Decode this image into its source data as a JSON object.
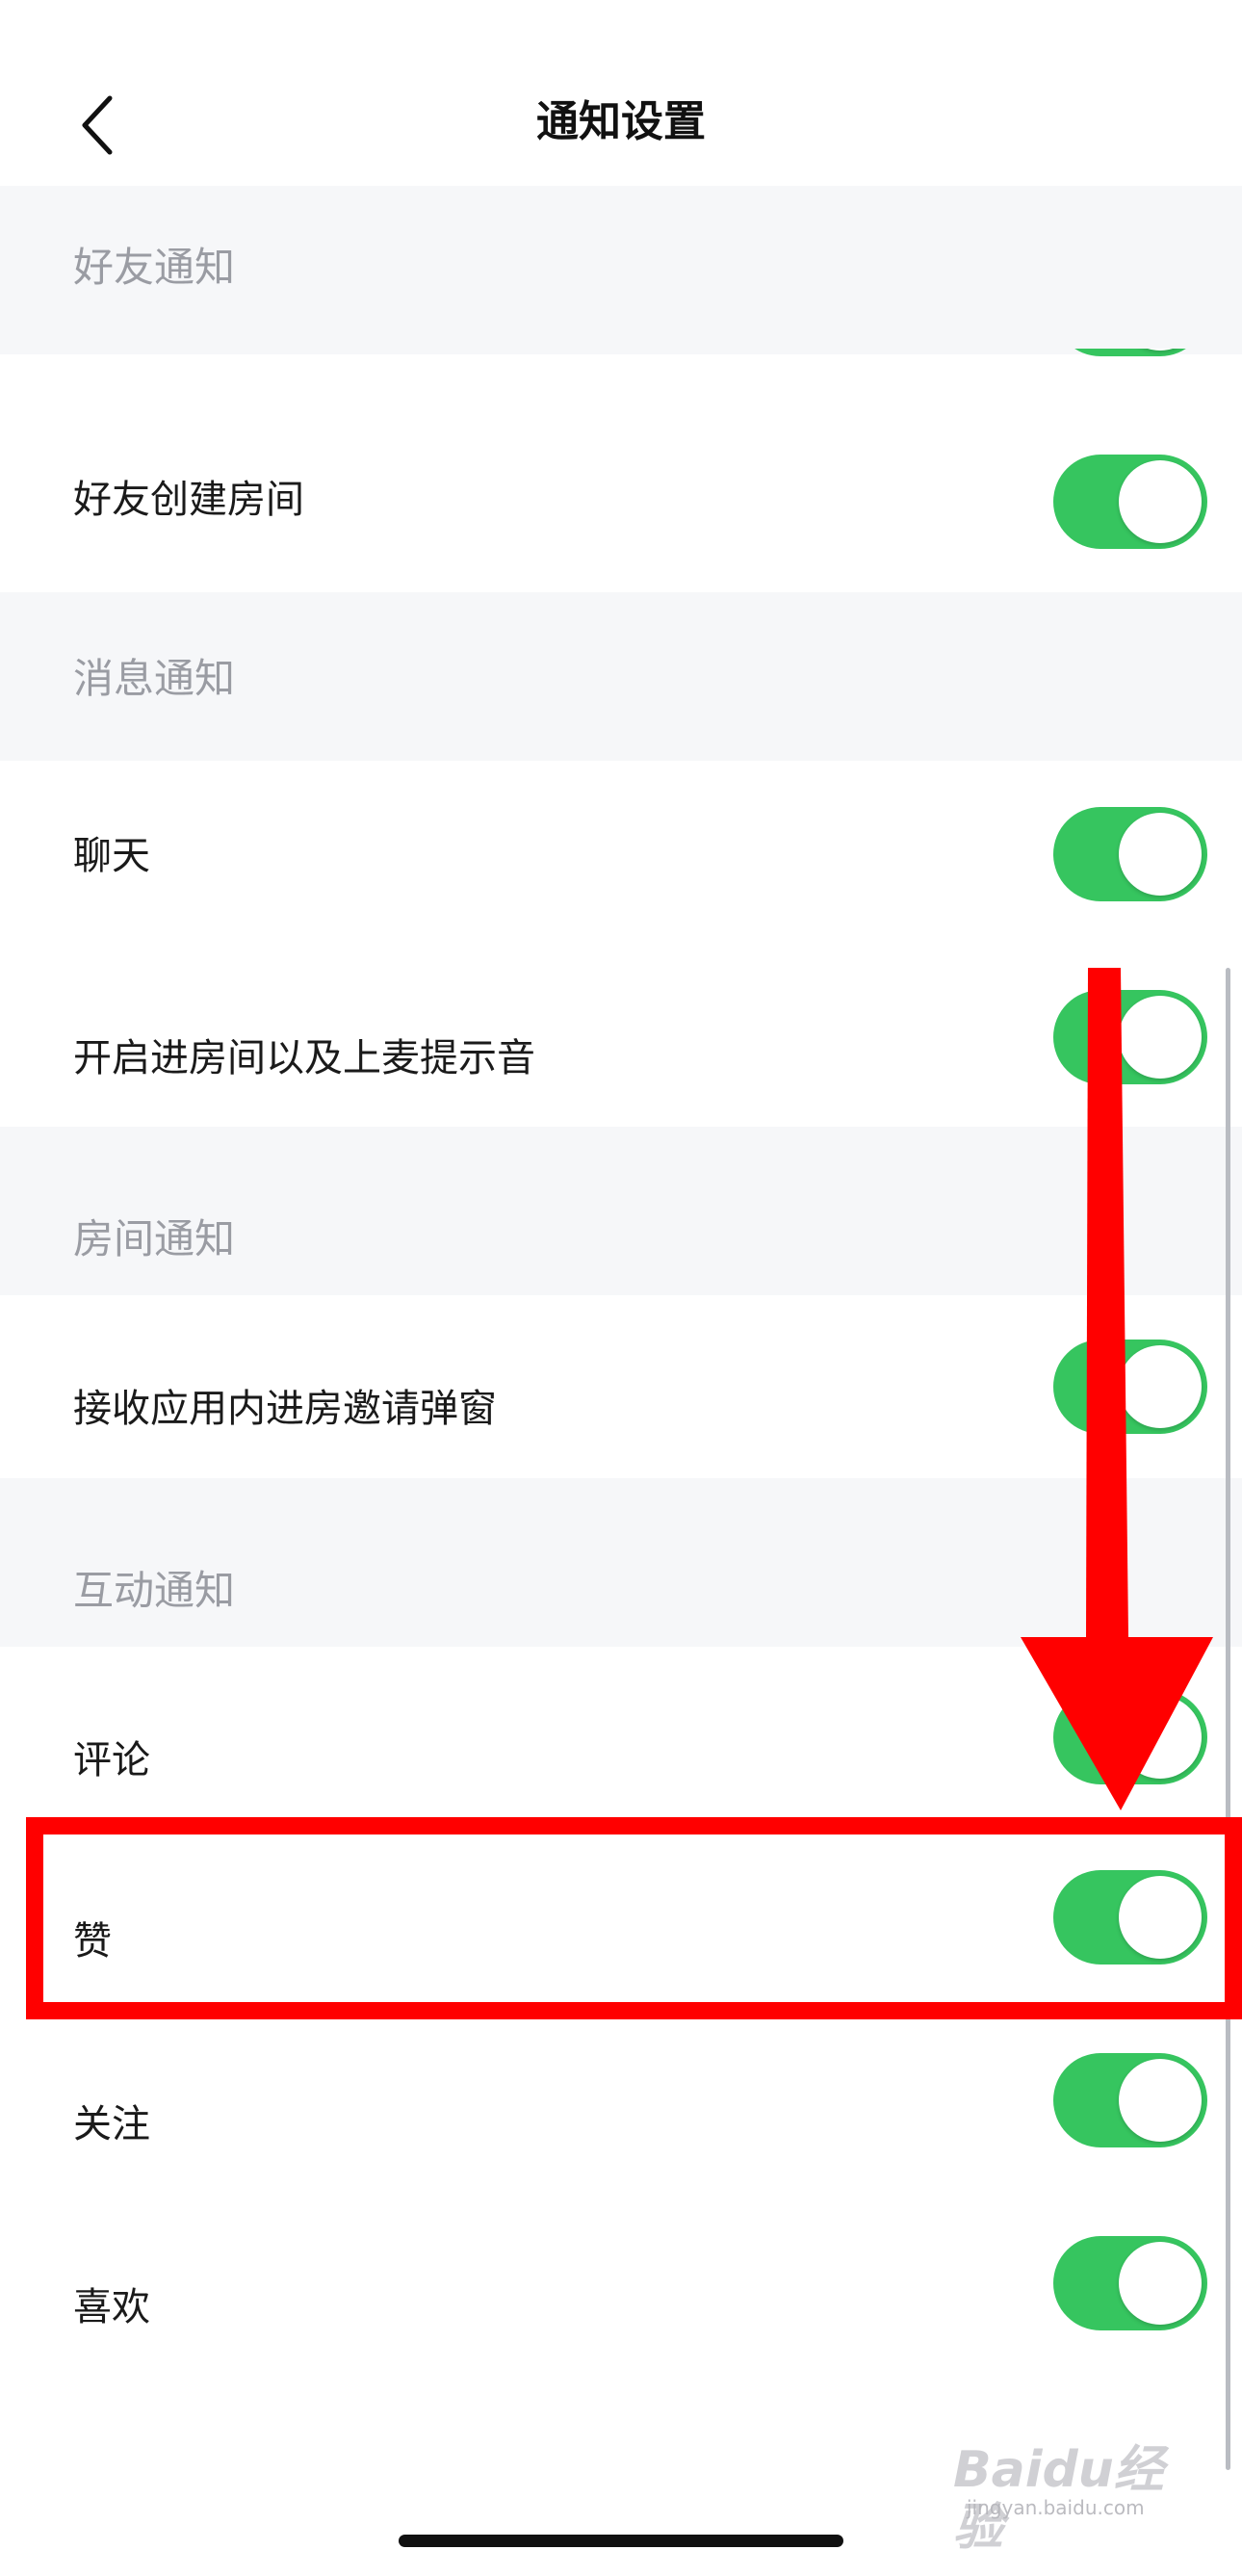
{
  "header": {
    "title": "通知设置",
    "back_icon": "chevron-left-icon"
  },
  "sections": {
    "friends": {
      "label": "好友通知"
    },
    "messages": {
      "label": "消息通知"
    },
    "rooms": {
      "label": "房间通知"
    },
    "interactions": {
      "label": "互动通知"
    }
  },
  "rows": {
    "friend_create_room": {
      "label": "好友创建房间",
      "on": true
    },
    "chat": {
      "label": "聊天",
      "on": true
    },
    "enter_room_mic_sound": {
      "label": "开启进房间以及上麦提示音",
      "on": true
    },
    "in_app_invite_popup": {
      "label": "接收应用内进房邀请弹窗",
      "on": true
    },
    "comment": {
      "label": "评论",
      "on": true
    },
    "like": {
      "label": "赞",
      "on": true
    },
    "follow": {
      "label": "关注",
      "on": true
    },
    "favorite": {
      "label": "喜欢",
      "on": true
    }
  },
  "colors": {
    "toggle_on": "#36c55f",
    "annotation": "#ff0000",
    "section_bg": "#f6f7f9"
  },
  "watermark": {
    "brand": "Baidu经验",
    "url": "jingyan.baidu.com"
  }
}
